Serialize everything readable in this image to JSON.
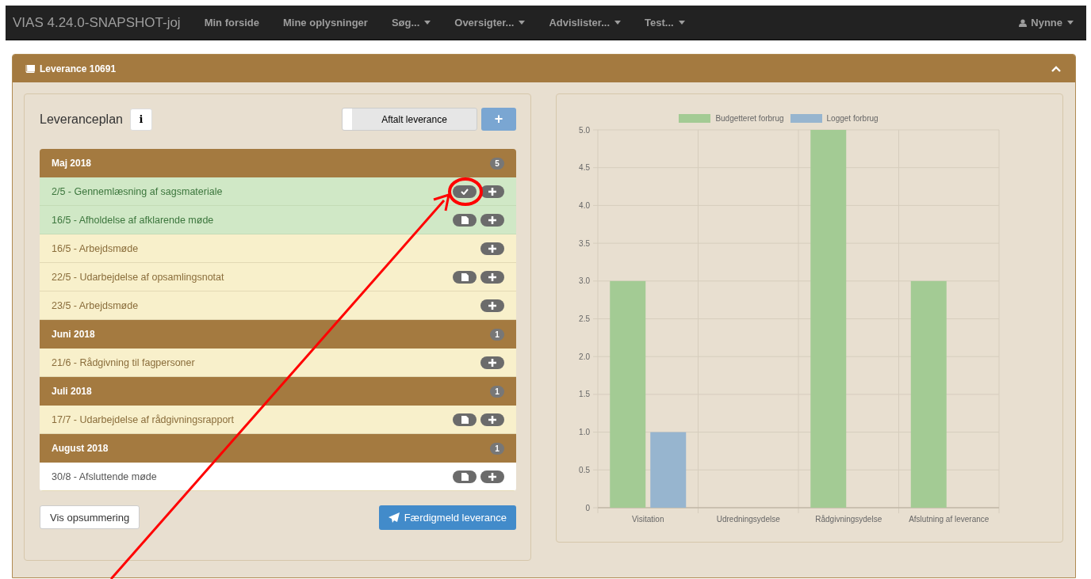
{
  "navbar": {
    "brand": "VIAS 4.24.0-SNAPSHOT-joj",
    "items": [
      {
        "label": "Min forside",
        "dropdown": false
      },
      {
        "label": "Mine oplysninger",
        "dropdown": false
      },
      {
        "label": "Søg...",
        "dropdown": true
      },
      {
        "label": "Oversigter...",
        "dropdown": true
      },
      {
        "label": "Advislister...",
        "dropdown": true
      },
      {
        "label": "Test...",
        "dropdown": true
      }
    ],
    "user": {
      "label": "Nynne",
      "dropdown": true
    }
  },
  "panel": {
    "title": "Leverance 10691",
    "expanded": true
  },
  "plan": {
    "title": "Leveranceplan",
    "info_button": "i",
    "toggle": {
      "label": "Aftalt leverance",
      "on": false
    },
    "add_button": "+",
    "months": [
      {
        "label": "Maj 2018",
        "count": "5",
        "items": [
          {
            "label": "2/5 - Gennemlæsning af sagsmateriale",
            "kind": "done",
            "actions": [
              {
                "kind": "check"
              },
              {
                "kind": "plus"
              }
            ]
          },
          {
            "label": "16/5 - Afholdelse af afklarende møde",
            "kind": "done",
            "actions": [
              {
                "kind": "document"
              },
              {
                "kind": "plus"
              }
            ]
          },
          {
            "label": "16/5 - Arbejdsmøde",
            "kind": "pending",
            "actions": [
              {
                "kind": "plus"
              }
            ]
          },
          {
            "label": "22/5 - Udarbejdelse af opsamlingsnotat",
            "kind": "pending",
            "actions": [
              {
                "kind": "document"
              },
              {
                "kind": "plus"
              }
            ]
          },
          {
            "label": "23/5 - Arbejdsmøde",
            "kind": "pending",
            "actions": [
              {
                "kind": "plus"
              }
            ]
          }
        ]
      },
      {
        "label": "Juni 2018",
        "count": "1",
        "items": [
          {
            "label": "21/6 - Rådgivning til fagpersoner",
            "kind": "pending",
            "actions": [
              {
                "kind": "plus"
              }
            ]
          }
        ]
      },
      {
        "label": "Juli 2018",
        "count": "1",
        "items": [
          {
            "label": "17/7 - Udarbejdelse af rådgivningsrapport",
            "kind": "pending",
            "actions": [
              {
                "kind": "document"
              },
              {
                "kind": "plus"
              }
            ]
          }
        ]
      },
      {
        "label": "August 2018",
        "count": "1",
        "items": [
          {
            "label": "30/8 - Afsluttende møde",
            "kind": "plain",
            "actions": [
              {
                "kind": "document"
              },
              {
                "kind": "plus"
              }
            ]
          }
        ]
      }
    ],
    "summary_button": "Vis opsummering",
    "complete_button": "Færdigmeld leverance"
  },
  "chart": {
    "chart_data": {
      "type": "bar",
      "categories": [
        "Visitation",
        "Udredningsydelse",
        "Rådgivningsydelse",
        "Afslutning af leverance"
      ],
      "series": [
        {
          "name": "Budgetteret forbrug",
          "color": "#a3cb94",
          "values": [
            3,
            0,
            5,
            3
          ]
        },
        {
          "name": "Logget forbrug",
          "color": "#97b5cf",
          "values": [
            1,
            0,
            0,
            0
          ]
        }
      ],
      "ylim": [
        0,
        5
      ],
      "yticks": [
        0,
        {
          "value": 0.5,
          "label": "0.5"
        },
        {
          "value": 1,
          "label": "1.0"
        },
        {
          "value": 1.5,
          "label": "1.5"
        },
        {
          "value": 2,
          "label": "2.0"
        },
        {
          "value": 2.5,
          "label": "2.5"
        },
        {
          "value": 3,
          "label": "3.0"
        },
        {
          "value": 3.5,
          "label": "3.5"
        },
        {
          "value": 4,
          "label": "4.0"
        },
        {
          "value": 4.5,
          "label": "4.5"
        },
        {
          "value": 5,
          "label": "5.0"
        }
      ],
      "grid": true,
      "legend": true
    }
  }
}
